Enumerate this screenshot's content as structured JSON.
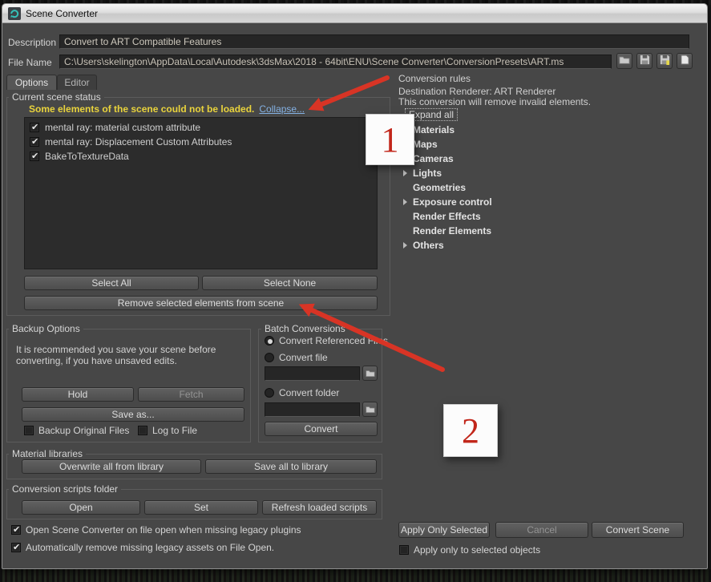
{
  "window": {
    "title": "Scene Converter"
  },
  "header": {
    "description_label": "Description",
    "description_value": "Convert to ART Compatible Features",
    "file_name_label": "File Name",
    "file_name_value": "C:\\Users\\skelington\\AppData\\Local\\Autodesk\\3dsMax\\2018 - 64bit\\ENU\\Scene Converter\\ConversionPresets\\ART.ms"
  },
  "tabs": [
    {
      "label": "Options",
      "active": true
    },
    {
      "label": "Editor",
      "active": false
    }
  ],
  "scene_status": {
    "group_label": "Current scene status",
    "warning_text": "Some elements of the scene could not be loaded.",
    "collapse_link": "Collapse...",
    "items": [
      {
        "label": "mental ray: material custom attribute",
        "checked": true
      },
      {
        "label": "mental ray: Displacement Custom Attributes",
        "checked": true
      },
      {
        "label": "BakeToTextureData",
        "checked": true
      }
    ],
    "select_all_label": "Select All",
    "select_none_label": "Select None",
    "remove_button_label": "Remove selected elements from scene"
  },
  "backup_options": {
    "group_label": "Backup Options",
    "note_line1": "It is recommended you save your scene before",
    "note_line2": "converting, if you have unsaved edits.",
    "hold_label": "Hold",
    "fetch_label": "Fetch",
    "save_as_label": "Save as...",
    "backup_original_label": "Backup Original Files",
    "backup_original_checked": false,
    "log_to_file_label": "Log to File",
    "log_to_file_checked": false
  },
  "batch_conversions": {
    "group_label": "Batch Conversions",
    "radios": [
      {
        "label": "Convert Referenced Files",
        "selected": true
      },
      {
        "label": "Convert file",
        "selected": false
      },
      {
        "label": "Convert folder",
        "selected": false
      }
    ],
    "file_input_value": "",
    "folder_input_value": "",
    "convert_label": "Convert"
  },
  "material_libraries": {
    "group_label": "Material libraries",
    "overwrite_label": "Overwrite all from library",
    "save_label": "Save all to library"
  },
  "conversion_scripts": {
    "group_label": "Conversion scripts folder",
    "open_label": "Open",
    "set_label": "Set",
    "refresh_label": "Refresh loaded scripts"
  },
  "footer": {
    "open_on_missing_label": "Open Scene Converter on file open when missing legacy plugins",
    "open_on_missing_checked": true,
    "auto_remove_label": "Automatically remove missing legacy assets on File Open.",
    "auto_remove_checked": true
  },
  "conversion_rules": {
    "title": "Conversion rules",
    "destination_line": "Destination Renderer: ART Renderer",
    "note_line": "This conversion will remove invalid elements.",
    "expand_all_label": "Expand all",
    "tree": [
      {
        "label": "Materials",
        "expandable": true
      },
      {
        "label": "Maps",
        "expandable": true
      },
      {
        "label": "Cameras",
        "expandable": true
      },
      {
        "label": "Lights",
        "expandable": true
      },
      {
        "label": "Geometries",
        "expandable": false
      },
      {
        "label": "Exposure control",
        "expandable": true
      },
      {
        "label": "Render Effects",
        "expandable": false
      },
      {
        "label": "Render Elements",
        "expandable": false
      },
      {
        "label": "Others",
        "expandable": true
      }
    ],
    "apply_only_selected_label": "Apply Only Selected",
    "cancel_label": "Cancel",
    "convert_scene_label": "Convert Scene",
    "apply_to_selected_label": "Apply only to selected objects",
    "apply_to_selected_checked": false
  },
  "annotations": {
    "badge_1": "1",
    "badge_2": "2",
    "arrow_color": "#d83425"
  },
  "colors": {
    "warning_text": "#e9d33c",
    "link": "#84b1e3",
    "dialog_bg": "#474747",
    "field_bg": "#262626",
    "annotation_red": "#d83425"
  },
  "icons": {
    "titlebar": [
      "scene-converter-app-icon",
      "minimize-icon",
      "maximize-icon",
      "close-icon"
    ],
    "preset_toolbar": [
      "open-folder-icon",
      "save-icon",
      "save-as-icon",
      "new-file-icon"
    ],
    "browse_buttons": "folder-icon",
    "tree_expander": "chevron-right-icon",
    "checkbox_check": "check-icon"
  }
}
